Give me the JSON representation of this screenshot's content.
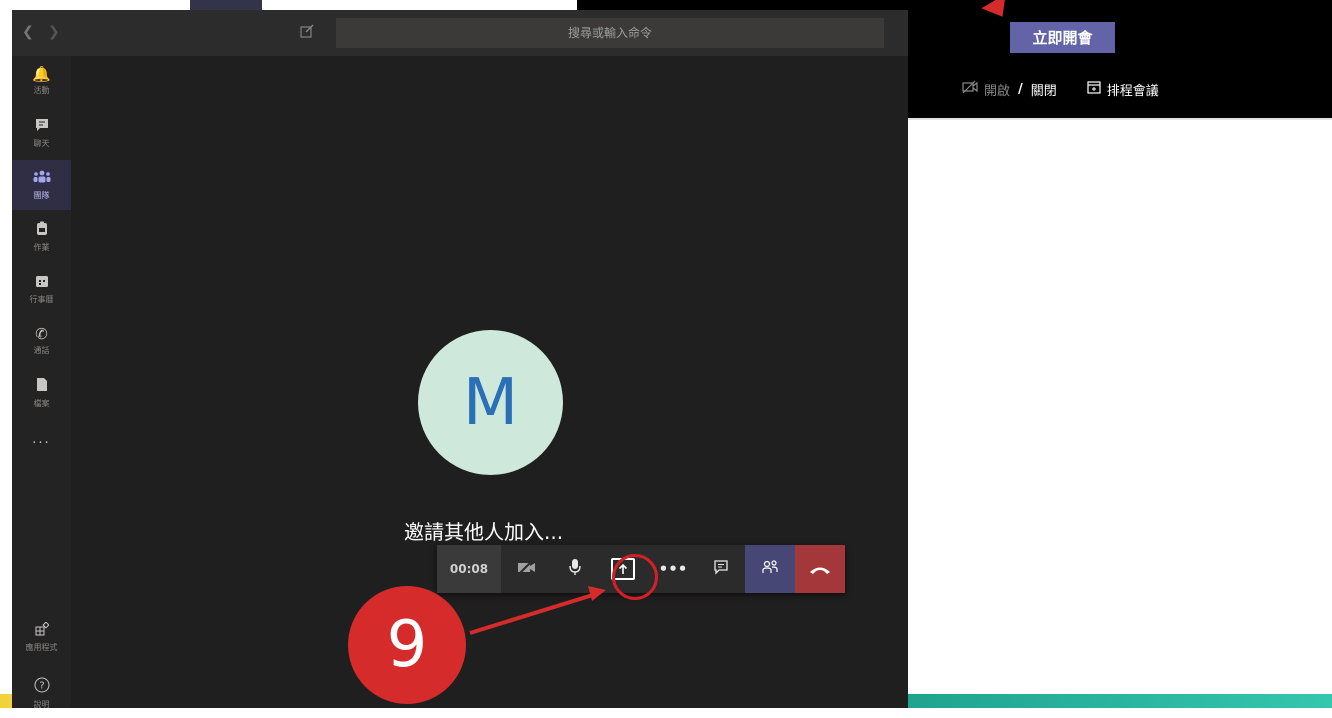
{
  "background_app": {
    "meet_now_label": "立即開會",
    "camera_toggle": {
      "off_label": "開啟",
      "separator": "/",
      "on_label": "關閉"
    },
    "schedule_label": "排程會議"
  },
  "teams": {
    "search_placeholder": "搜尋或輸入命令",
    "rail": [
      {
        "icon": "bell-icon",
        "label": "活動"
      },
      {
        "icon": "chat-icon",
        "label": "聊天"
      },
      {
        "icon": "teams-icon",
        "label": "團隊"
      },
      {
        "icon": "assignments-icon",
        "label": "作業"
      },
      {
        "icon": "calendar-icon",
        "label": "行事曆"
      },
      {
        "icon": "phone-icon",
        "label": "通話"
      },
      {
        "icon": "files-icon",
        "label": "檔案"
      },
      {
        "icon": "more-icon",
        "label": "..."
      }
    ],
    "rail_bottom": [
      {
        "icon": "apps-icon",
        "label": "應用程式"
      },
      {
        "icon": "help-icon",
        "label": "說明"
      }
    ],
    "meeting": {
      "avatar_initial": "M",
      "invite_text": "邀請其他人加入...",
      "timer": "00:08"
    }
  },
  "annotation": {
    "step_number": "9"
  },
  "colors": {
    "accent": "#6264a7",
    "hangup": "#a4373a",
    "annotation": "#d62b2b"
  }
}
